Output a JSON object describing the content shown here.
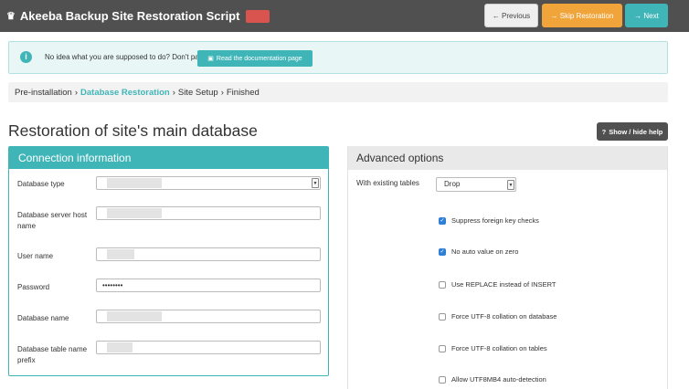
{
  "header": {
    "title": "Akeeba Backup Site Restoration Script",
    "logo_icon": "♛",
    "previous": "← Previous",
    "skip": "→ Skip Restoration",
    "next": "→ Next",
    "accent_color": "#40b5b8",
    "skip_color": "#f0a43a"
  },
  "info": {
    "text": "No idea what you are supposed to do? Don't panic!",
    "doc_button": "Read the documentation page"
  },
  "breadcrumb": {
    "items": [
      "Pre-installation",
      "Database Restoration",
      "Site Setup",
      "Finished"
    ]
  },
  "page": {
    "title": "Restoration of site's main database",
    "help_button": "Show / hide help"
  },
  "connection": {
    "header": "Connection information",
    "fields": [
      {
        "label": "Database type"
      },
      {
        "label": "Database server host name"
      },
      {
        "label": "User name"
      },
      {
        "label": "Password",
        "value": "••••••••"
      },
      {
        "label": "Database name"
      },
      {
        "label": "Database table name prefix"
      }
    ]
  },
  "advanced": {
    "header": "Advanced options",
    "existing_tables_label": "With existing tables",
    "existing_tables_value": "Drop",
    "options": [
      {
        "label": "Suppress foreign key checks",
        "checked": true
      },
      {
        "label": "No auto value on zero",
        "checked": true
      },
      {
        "label": "Use REPLACE instead of INSERT",
        "checked": false
      },
      {
        "label": "Force UTF-8 collation on database",
        "checked": false
      },
      {
        "label": "Force UTF-8 collation on tables",
        "checked": false
      },
      {
        "label": "Allow UTF8MB4 auto-detection",
        "checked": false
      }
    ]
  }
}
